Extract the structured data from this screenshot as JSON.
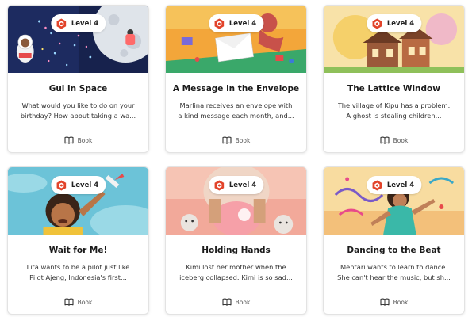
{
  "colors": {
    "badge_accent": "#e2432a",
    "card_border": "#e3e3e3"
  },
  "cards": [
    {
      "level": "Level 4",
      "title": "Gul in Space",
      "desc1": "What would you like to do on your",
      "desc2": "birthday? How about taking a wa...",
      "type": "Book",
      "icon": "book-icon"
    },
    {
      "level": "Level 4",
      "title": "A Message in the Envelope",
      "desc1": "Marlina receives an envelope with",
      "desc2": "a kind message each month, and...",
      "type": "Book",
      "icon": "book-icon"
    },
    {
      "level": "Level 4",
      "title": "The Lattice Window",
      "desc1": "The village of Kipu has a problem.",
      "desc2": "A ghost is stealing children...",
      "type": "Book",
      "icon": "book-icon"
    },
    {
      "level": "Level 4",
      "title": "Wait for Me!",
      "desc1": "Lita wants to be a pilot just like",
      "desc2": "Pilot Ajeng, Indonesia's first...",
      "type": "Book",
      "icon": "book-icon"
    },
    {
      "level": "Level 4",
      "title": "Holding Hands",
      "desc1": "Kimi lost her mother when the",
      "desc2": "iceberg collapsed. Kimi is so sad...",
      "type": "Book",
      "icon": "book-icon"
    },
    {
      "level": "Level 4",
      "title": "Dancing to the Beat",
      "desc1": "Mentari wants to learn to dance.",
      "desc2": "She can't hear the music, but sh...",
      "type": "Book",
      "icon": "book-icon"
    }
  ]
}
